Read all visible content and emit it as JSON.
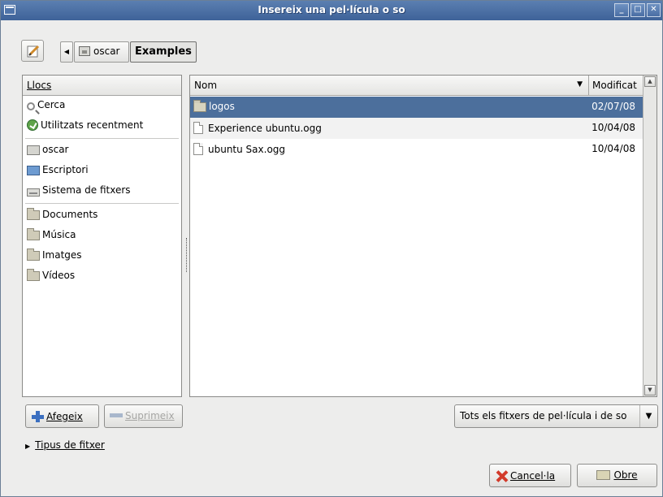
{
  "window": {
    "title": "Insereix una pel·lícula o so",
    "minimize_glyph": "_",
    "maximize_glyph": "□",
    "close_glyph": "✕"
  },
  "toolbar": {
    "back_glyph": "◀",
    "breadcrumbs": [
      {
        "label": "oscar"
      },
      {
        "label": "Examples"
      }
    ]
  },
  "places": {
    "header": "Llocs",
    "items": [
      {
        "label": "Cerca",
        "icon": "search-icon"
      },
      {
        "label": "Utilitzats recentment",
        "icon": "recent-icon"
      },
      {
        "label": "oscar",
        "icon": "home-folder-icon"
      },
      {
        "label": "Escriptori",
        "icon": "desktop-icon"
      },
      {
        "label": "Sistema de fitxers",
        "icon": "drive-icon"
      },
      {
        "label": "Documents",
        "icon": "folder-icon"
      },
      {
        "label": "Música",
        "icon": "folder-icon"
      },
      {
        "label": "Imatges",
        "icon": "folder-icon"
      },
      {
        "label": "Vídeos",
        "icon": "folder-icon"
      }
    ]
  },
  "files": {
    "col_name": "Nom",
    "col_modified": "Modificat",
    "sort_glyph": "▼",
    "rows": [
      {
        "name": "logos",
        "date": "02/07/08",
        "type": "folder",
        "selected": true
      },
      {
        "name": "Experience ubuntu.ogg",
        "date": "10/04/08",
        "type": "file",
        "selected": false
      },
      {
        "name": "ubuntu Sax.ogg",
        "date": "10/04/08",
        "type": "file",
        "selected": false
      }
    ]
  },
  "buttons": {
    "add_label": "Afegeix",
    "remove_label": "Suprimeix",
    "cancel_label": "Cancel·la",
    "open_label": "Obre"
  },
  "filter": {
    "selected": "Tots els fitxers de pel·lícula i de so",
    "arrow_glyph": "▼"
  },
  "expander": {
    "label": "Tipus de fitxer",
    "glyph": "▶"
  },
  "colors": {
    "titlebar": "#4a6fa5",
    "selection": "#4c6f9c"
  }
}
